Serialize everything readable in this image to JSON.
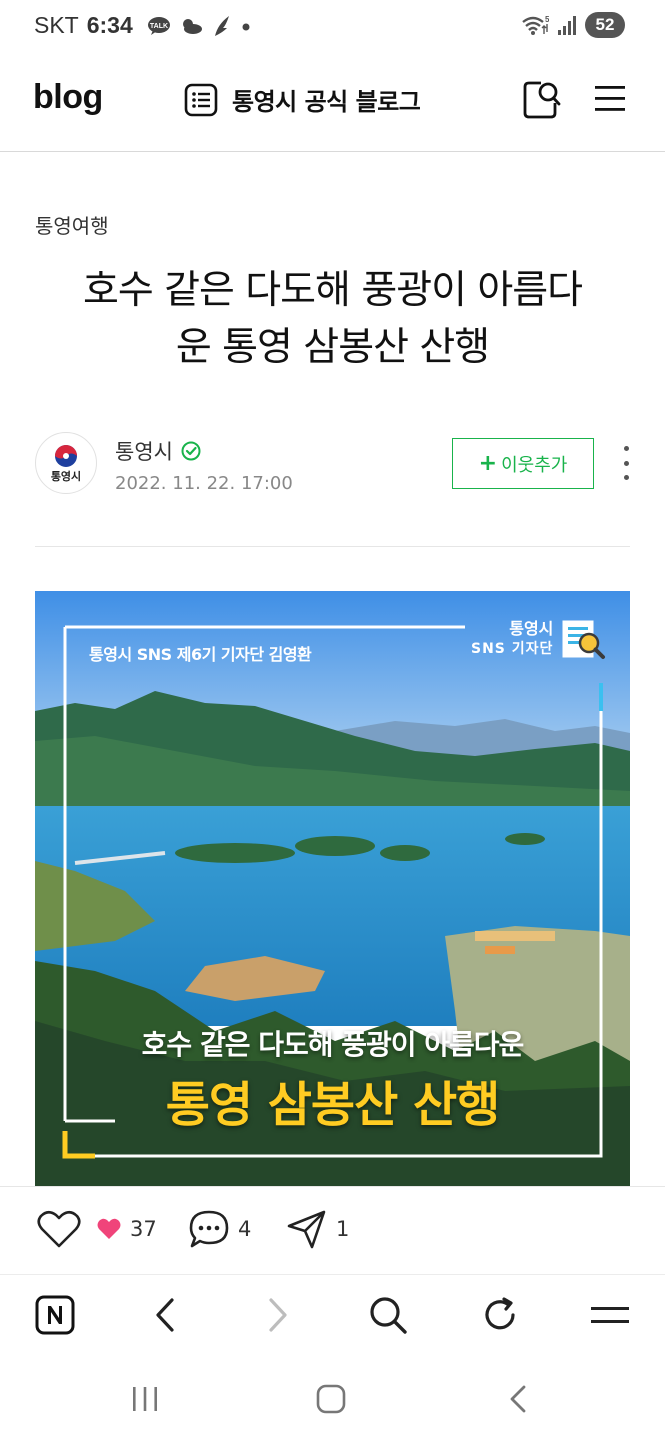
{
  "status_bar": {
    "carrier": "SKT",
    "time": "6:34",
    "battery": "52",
    "icons": [
      "talk-icon",
      "weather-icon",
      "bird-icon",
      "dot-icon",
      "wifi-icon",
      "signal-icon"
    ]
  },
  "header": {
    "logo": "blog",
    "blog_title": "통영시 공식 블로그",
    "icons": [
      "list-icon",
      "search-icon",
      "menu-icon"
    ]
  },
  "post": {
    "category": "통영여행",
    "title_line1": "호수 같은 다도해 풍광이 아름다",
    "title_line2": "운 통영 삼봉산 산행",
    "author": "통영시",
    "avatar_label": "통영시",
    "date": "2022. 11. 22. 17:00",
    "follow_label": "이웃추가",
    "follow_icon": "+"
  },
  "hero": {
    "reporter": "통영시 SNS 제6기 기자단 김영환",
    "badge_line1": "통영시",
    "badge_line2": "SNS 기자단",
    "subtitle": "호수 같은 다도해 풍광이 아름다운",
    "headline": "통영 삼봉산 산행"
  },
  "reactions": {
    "likes": "37",
    "comments": "4",
    "shares": "1",
    "like_color": "#f0447a"
  },
  "colors": {
    "accent_green": "#19b34b",
    "headline_yellow": "#ffcc22"
  }
}
